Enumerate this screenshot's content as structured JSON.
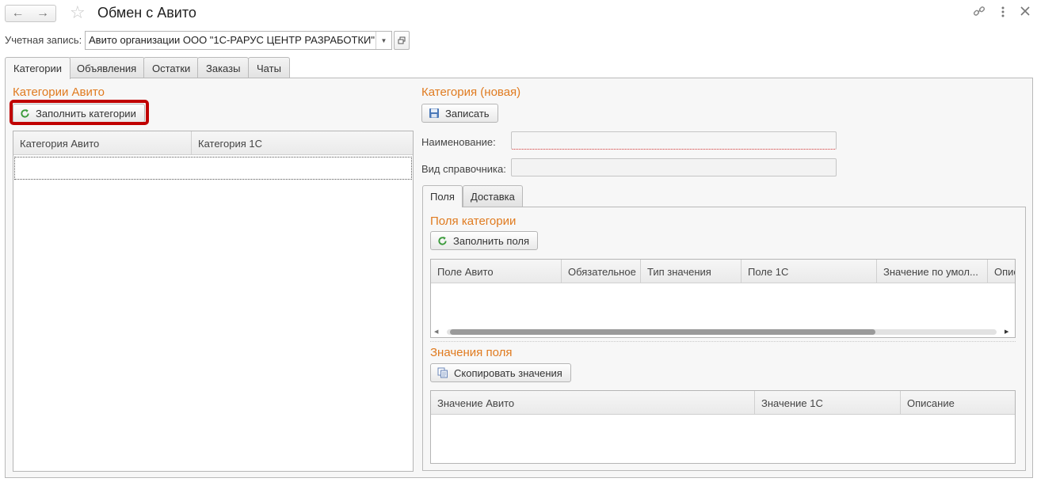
{
  "window": {
    "title": "Обмен с Авито",
    "back_glyph": "←",
    "forward_glyph": "→"
  },
  "account": {
    "label": "Учетная запись:",
    "value": "Авито организации ООО \"1С-РАРУС ЦЕНТР РАЗРАБОТКИ\""
  },
  "tabs": [
    {
      "label": "Категории",
      "active": true
    },
    {
      "label": "Объявления",
      "active": false
    },
    {
      "label": "Остатки",
      "active": false
    },
    {
      "label": "Заказы",
      "active": false
    },
    {
      "label": "Чаты",
      "active": false
    }
  ],
  "left": {
    "section_title": "Категории Авито",
    "fill_button": "Заполнить категории",
    "columns": [
      "Категория Авито",
      "Категория 1С"
    ]
  },
  "right": {
    "section_title": "Категория (новая)",
    "save_button": "Записать",
    "name_label": "Наименование:",
    "name_value": "",
    "kind_label": "Вид справочника:",
    "kind_value": "",
    "subtabs": [
      {
        "label": "Поля",
        "active": true
      },
      {
        "label": "Доставка",
        "active": false
      }
    ],
    "fields_section_title": "Поля категории",
    "fill_fields_button": "Заполнить поля",
    "fields_columns": [
      "Поле Авито",
      "Обязательное",
      "Тип значения",
      "Поле 1С",
      "Значение по умол...",
      "Опис"
    ],
    "values_section_title": "Значения поля",
    "copy_values_button": "Скопировать значения",
    "values_columns": [
      "Значение Авито",
      "Значение 1С",
      "Описание"
    ]
  },
  "colors": {
    "accent": "#e07b20",
    "highlight": "#c00000",
    "refresh_green": "#3a9a3a"
  }
}
